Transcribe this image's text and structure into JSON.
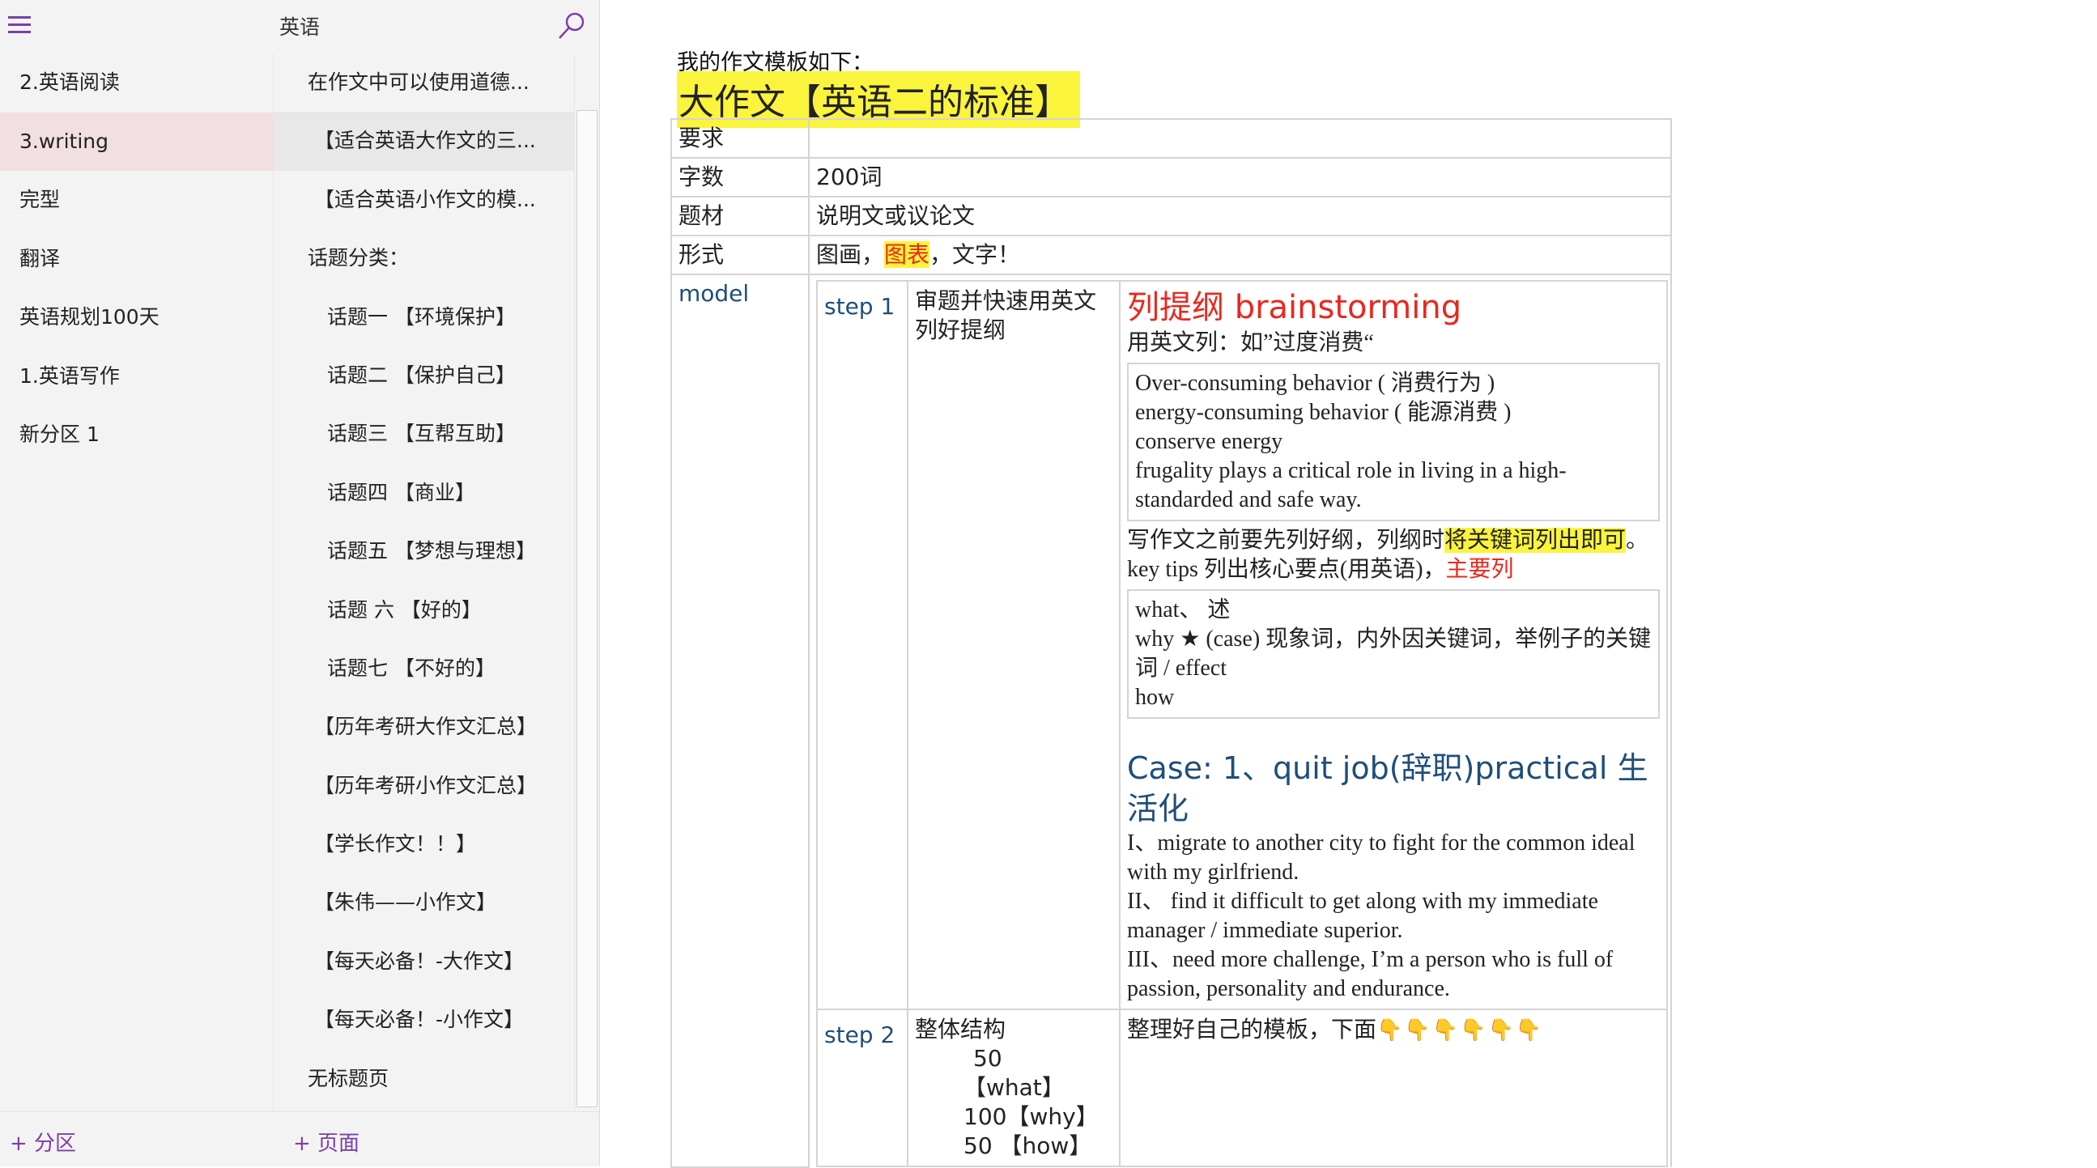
{
  "header": {
    "notebook_title": "英语"
  },
  "sections": [
    {
      "label": "2.英语阅读"
    },
    {
      "label": "3.writing"
    },
    {
      "label": "完型"
    },
    {
      "label": "翻译"
    },
    {
      "label": "英语规划100天"
    },
    {
      "label": "1.英语写作"
    },
    {
      "label": "新分区 1"
    }
  ],
  "pages": [
    {
      "label": "在作文中可以使用道德..."
    },
    {
      "label": "【适合英语大作文的三..."
    },
    {
      "label": "【适合英语小作文的模..."
    },
    {
      "label": "话题分类："
    },
    {
      "label": "话题一 【环境保护】"
    },
    {
      "label": "话题二 【保护自己】"
    },
    {
      "label": "话题三 【互帮互助】"
    },
    {
      "label": "话题四 【商业】"
    },
    {
      "label": "话题五 【梦想与理想】"
    },
    {
      "label": "话题 六 【好的】"
    },
    {
      "label": "话题七 【不好的】"
    },
    {
      "label": "【历年考研大作文汇总】"
    },
    {
      "label": "【历年考研小作文汇总】"
    },
    {
      "label": "【学长作文！！】"
    },
    {
      "label": "【朱伟——小作文】"
    },
    {
      "label": "【每天必备！-大作文】"
    },
    {
      "label": "【每天必备！-小作文】"
    },
    {
      "label": "无标题页"
    }
  ],
  "footer": {
    "add_section": "+ 分区",
    "add_page": "+ 页面"
  },
  "note": {
    "intro": "我的作文模板如下：",
    "title": "大作文【英语二的标准】",
    "rows": [
      {
        "label": "要求",
        "value": ""
      },
      {
        "label": "字数",
        "value": "200词"
      },
      {
        "label": "题材",
        "value": "说明文或议论文"
      }
    ],
    "form": {
      "label": "形式",
      "part1": "图画，",
      "part2": "图表",
      "part3": "，文字！"
    },
    "model_label": "model",
    "step1": {
      "step_label": "step 1",
      "desc": "审题并快速用英文列好提纲",
      "heading": "列提纲 brainstorming",
      "intro": "用英文列：如”过度消费“",
      "box1": [
        "Over-consuming behavior ( 消费行为 )",
        "energy-consuming behavior ( 能源消费 )",
        "conserve energy",
        "frugality plays a critical role in living in a high-standarded and safe way."
      ],
      "tip_part1": "写作文之前要先列好纲，列纲时",
      "tip_highlight": "将关键词列出即可",
      "tip_part2": "。 key tips 列出核心要点(用英语)，",
      "tip_red": "主要列",
      "box2": [
        "what、 述",
        "why ★ (case) 现象词，内外因关键词，举例子的关键词 / effect",
        "how"
      ],
      "case_title": "Case: 1、quit job(辞职)practical 生活化",
      "case_lines": [
        "I、migrate to another city to fight for the common ideal with my girlfriend.",
        "II、 find it difficult to get along with my immediate manager / immediate superior.",
        "III、need more challenge, I’m a person who is full of passion, personality and endurance."
      ]
    },
    "step2": {
      "step_label": "step 2",
      "desc_title": "整体结构",
      "desc_lines": [
        "50",
        "【what】",
        "100【why】",
        "50 【how】"
      ],
      "content": "整理好自己的模板，下面",
      "hands": "👇👇👇👇👇👇"
    }
  },
  "colors": {
    "accent": "#7b3fa8",
    "highlight": "#fbf43d",
    "red": "#e8281e",
    "heading_blue": "#1f4e79",
    "active_section": "#f2dfe2"
  }
}
